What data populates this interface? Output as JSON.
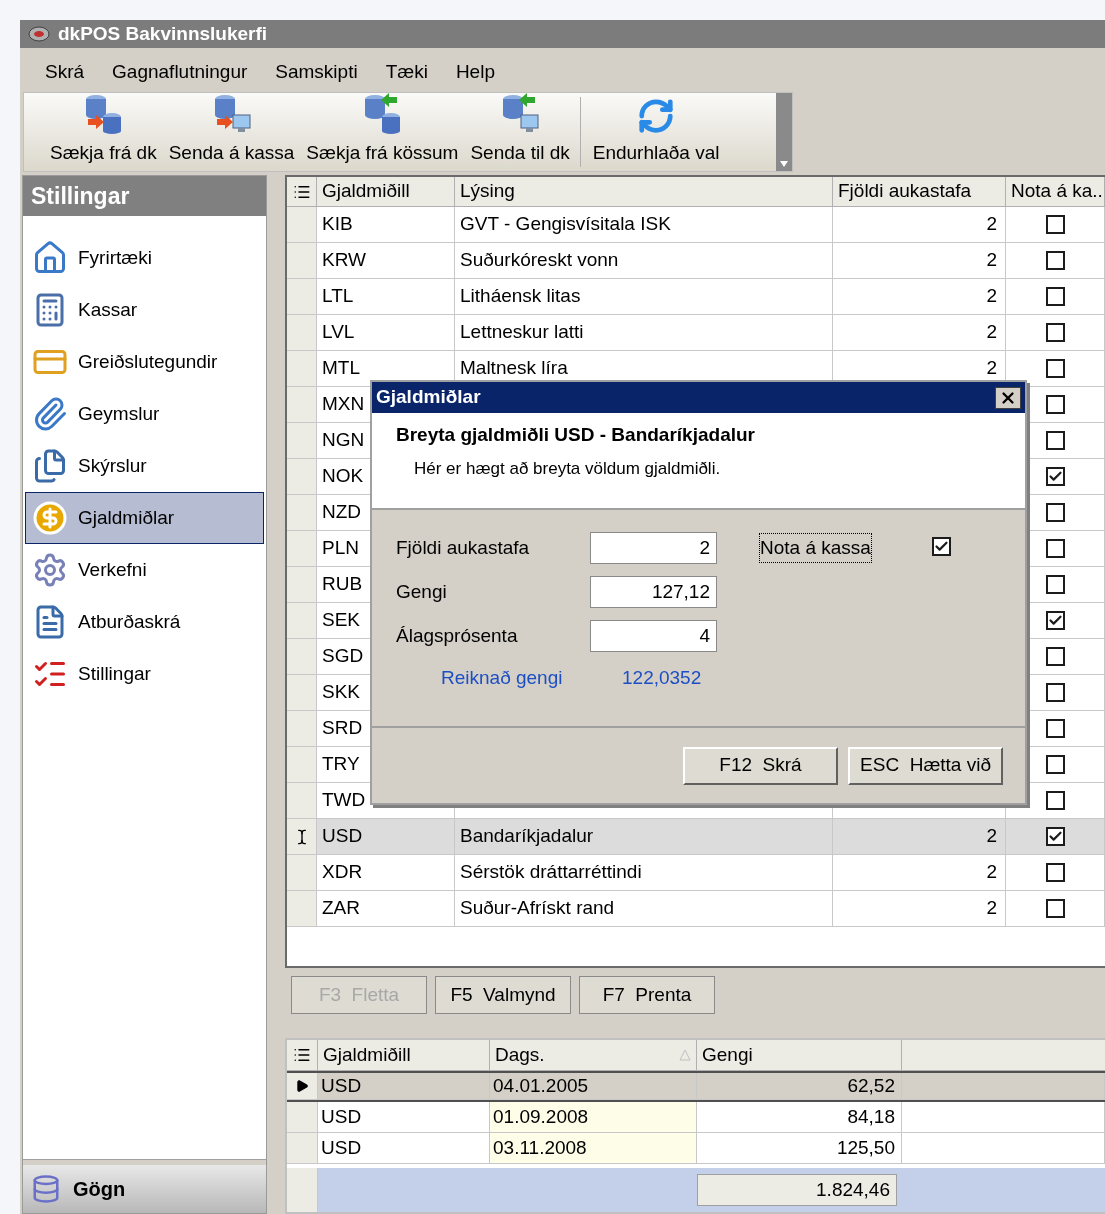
{
  "window": {
    "title": "dkPOS Bakvinnslukerfi"
  },
  "menu": [
    "Skrá",
    "Gagnaflutningur",
    "Samskipti",
    "Tæki",
    "Help"
  ],
  "toolbar": [
    "Sækja frá dk",
    "Senda á kassa",
    "Sækja frá kössum",
    "Senda til dk",
    "Endurhlaða val"
  ],
  "sidebar": {
    "title": "Stillingar",
    "items": [
      {
        "label": "Fyrirtæki",
        "selected": false
      },
      {
        "label": "Kassar",
        "selected": false
      },
      {
        "label": "Greiðslutegundir",
        "selected": false
      },
      {
        "label": "Geymslur",
        "selected": false
      },
      {
        "label": "Skýrslur",
        "selected": false
      },
      {
        "label": "Gjaldmiðlar",
        "selected": true
      },
      {
        "label": "Verkefni",
        "selected": false
      },
      {
        "label": "Atburðaskrá",
        "selected": false
      },
      {
        "label": "Stillingar",
        "selected": false
      }
    ],
    "footer_button": "Gögn"
  },
  "grid": {
    "columns": [
      "Gjaldmiðill",
      "Lýsing",
      "Fjöldi aukastafa",
      "Nota á ka..."
    ],
    "rows": [
      {
        "code": "KIB",
        "description": "GVT - Gengisvísitala ISK",
        "decimals": "2",
        "use_at_register": false,
        "selected": false
      },
      {
        "code": "KRW",
        "description": "Suðurkóreskt vonn",
        "decimals": "2",
        "use_at_register": false,
        "selected": false
      },
      {
        "code": "LTL",
        "description": "Litháensk litas",
        "decimals": "2",
        "use_at_register": false,
        "selected": false
      },
      {
        "code": "LVL",
        "description": "Lettneskur latti",
        "decimals": "2",
        "use_at_register": false,
        "selected": false
      },
      {
        "code": "MTL",
        "description": "Maltnesk líra",
        "decimals": "2",
        "use_at_register": false,
        "selected": false
      },
      {
        "code": "MXN",
        "use_at_register": false,
        "selected": false
      },
      {
        "code": "NGN",
        "use_at_register": false,
        "selected": false
      },
      {
        "code": "NOK",
        "use_at_register": true,
        "selected": false
      },
      {
        "code": "NZD",
        "use_at_register": false,
        "selected": false
      },
      {
        "code": "PLN",
        "use_at_register": false,
        "selected": false
      },
      {
        "code": "RUB",
        "use_at_register": false,
        "selected": false
      },
      {
        "code": "SEK",
        "use_at_register": true,
        "selected": false
      },
      {
        "code": "SGD",
        "use_at_register": false,
        "selected": false
      },
      {
        "code": "SKK",
        "use_at_register": false,
        "selected": false
      },
      {
        "code": "SRD",
        "use_at_register": false,
        "selected": false
      },
      {
        "code": "TRY",
        "use_at_register": false,
        "selected": false
      },
      {
        "code": "TWD",
        "use_at_register": false,
        "selected": false
      },
      {
        "code": "USD",
        "description": "Bandaríkjadalur",
        "decimals": "2",
        "use_at_register": true,
        "selected": true
      },
      {
        "code": "XDR",
        "description": "Sérstök dráttarréttindi",
        "decimals": "2",
        "use_at_register": false,
        "selected": false
      },
      {
        "code": "ZAR",
        "description": "Suður-Afrískt rand",
        "decimals": "2",
        "use_at_register": false,
        "selected": false
      }
    ]
  },
  "actions": [
    {
      "label": "F3  Fletta",
      "disabled": true
    },
    {
      "label": "F5  Valmynd",
      "disabled": false
    },
    {
      "label": "F7  Prenta",
      "disabled": false
    }
  ],
  "history": {
    "columns": [
      "Gjaldmiðill",
      "Dags.",
      "Gengi"
    ],
    "rows": [
      {
        "currency": "USD",
        "date": "04.01.2005",
        "rate": "62,52",
        "selected": true
      },
      {
        "currency": "USD",
        "date": "01.09.2008",
        "rate": "84,18",
        "selected": false
      },
      {
        "currency": "USD",
        "date": "03.11.2008",
        "rate": "125,50",
        "selected": false
      }
    ],
    "total": "1.824,46"
  },
  "dialog": {
    "title": "Gjaldmiðlar",
    "heading": "Breyta gjaldmiðli USD - Bandaríkjadalur",
    "subtitle": "Hér er hægt að breyta völdum gjaldmiðli.",
    "fields": [
      {
        "label": "Fjöldi aukastafa",
        "value": "2"
      },
      {
        "label": "Gengi",
        "value": "127,12"
      },
      {
        "label": "Álagsprósenta",
        "value": "4"
      }
    ],
    "checkbox": {
      "label": "Nota á kassa",
      "checked": true
    },
    "computed": {
      "label": "Reiknað gengi",
      "value": "122,0352"
    },
    "buttons": [
      "F12  Skrá",
      "ESC  Hætta við"
    ]
  }
}
